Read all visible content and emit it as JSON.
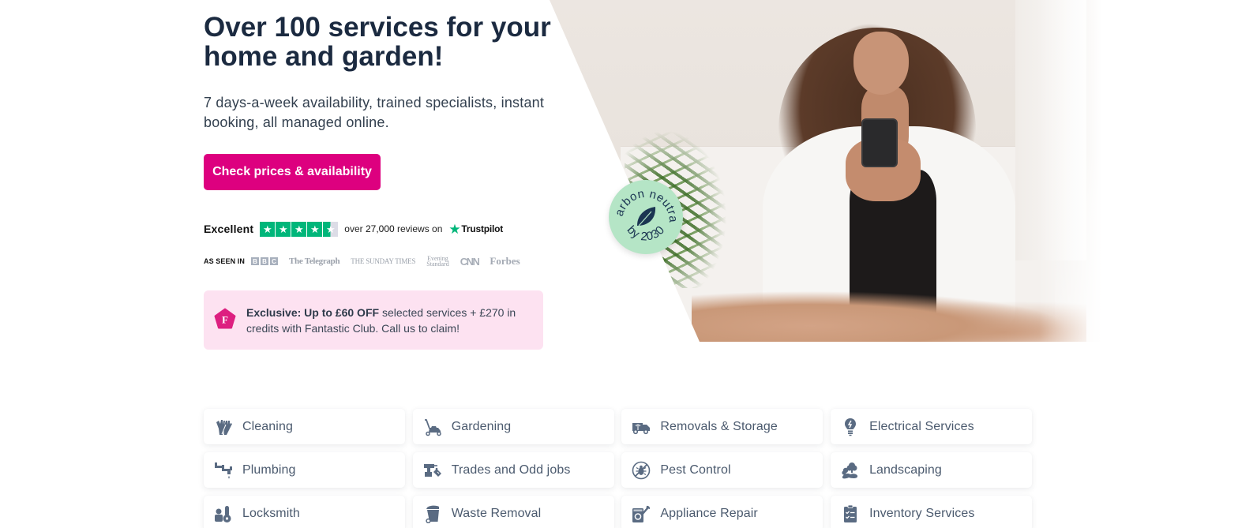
{
  "hero": {
    "title": "Over 100 services for your home and garden!",
    "subtitle": "7 days-a-week availability, trained specialists, instant booking, all managed online.",
    "cta_label": "Check prices & availability",
    "badge": {
      "text_top": "Carbon neutral",
      "text_bottom": "by 2030",
      "icon": "leaf-icon"
    }
  },
  "trustpilot": {
    "rating_label": "Excellent",
    "stars": 4.5,
    "reviews_prefix": "over",
    "reviews_count": "27,000",
    "reviews_suffix": "reviews on",
    "brand": "Trustpilot"
  },
  "as_seen_in": {
    "label": "AS SEEN IN",
    "logos": [
      "BBC",
      "The Telegraph",
      "THE SUNDAY TIMES",
      "Evening Standard",
      "CNN",
      "Forbes"
    ]
  },
  "promo": {
    "icon": "fantastic-club-icon",
    "icon_letter": "F",
    "bold_text": "Exclusive: Up to £60 OFF",
    "text": "selected services + £270 in credits with Fantastic Club. Call us to claim!"
  },
  "colors": {
    "brand_pink": "#dd007f",
    "promo_bg": "#fde2f1",
    "trustpilot_green": "#00b67a",
    "badge_green": "#b5e5c6",
    "navy": "#1b2a40",
    "icon_slate": "#5a6b82"
  },
  "services": [
    {
      "label": "Cleaning",
      "icon": "gloves-icon"
    },
    {
      "label": "Gardening",
      "icon": "lawn-mower-icon"
    },
    {
      "label": "Removals & Storage",
      "icon": "moving-van-icon"
    },
    {
      "label": "Electrical Services",
      "icon": "lightbulb-icon"
    },
    {
      "label": "Plumbing",
      "icon": "pipe-icon"
    },
    {
      "label": "Trades and Odd jobs",
      "icon": "drill-icon"
    },
    {
      "label": "Pest Control",
      "icon": "no-bug-icon"
    },
    {
      "label": "Landscaping",
      "icon": "trees-icon"
    },
    {
      "label": "Locksmith",
      "icon": "key-lock-icon"
    },
    {
      "label": "Waste Removal",
      "icon": "wheelie-bin-icon"
    },
    {
      "label": "Appliance Repair",
      "icon": "washing-machine-wrench-icon"
    },
    {
      "label": "Inventory Services",
      "icon": "clipboard-check-icon"
    }
  ]
}
